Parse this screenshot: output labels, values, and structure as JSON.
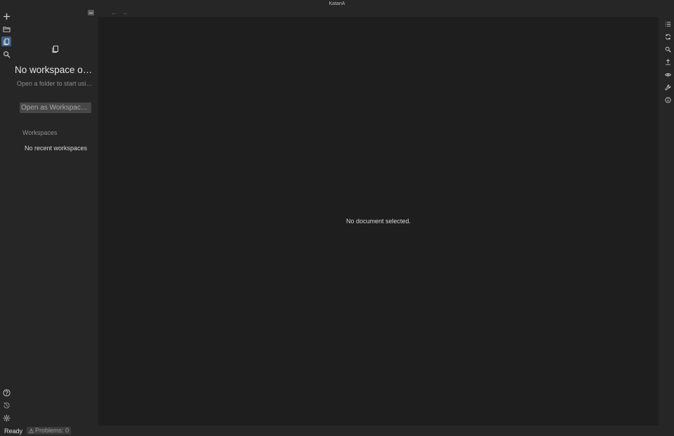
{
  "window": {
    "title": "KatanA"
  },
  "activity_bar": {
    "items": [
      {
        "name": "new-icon",
        "active": false
      },
      {
        "name": "folder-open-icon",
        "active": false
      },
      {
        "name": "explorer-icon",
        "active": true
      },
      {
        "name": "search-icon",
        "active": false
      }
    ],
    "bottom_items": [
      {
        "name": "help-icon"
      },
      {
        "name": "history-icon"
      },
      {
        "name": "settings-icon"
      }
    ]
  },
  "sidebar": {
    "empty_title": "No workspace op…",
    "empty_subtitle": "Open a folder to start usin…",
    "open_button": "Open as Workspace…",
    "section_title": "Workspaces",
    "section_empty": "No recent workspaces"
  },
  "editor": {
    "nav": {
      "back": "←",
      "forward": "→"
    },
    "empty_message": "No document selected."
  },
  "right_bar": {
    "items": [
      {
        "name": "outline-icon"
      },
      {
        "name": "refresh-icon"
      },
      {
        "name": "search-icon"
      },
      {
        "name": "export-icon"
      },
      {
        "name": "preview-icon"
      },
      {
        "name": "tools-icon"
      },
      {
        "name": "info-icon"
      }
    ]
  },
  "status_bar": {
    "ready": "Ready",
    "problems": "Problems: 0"
  },
  "colors": {
    "background": "#262626",
    "editor": "#1e1e1e",
    "accent": "#3a5f86"
  }
}
